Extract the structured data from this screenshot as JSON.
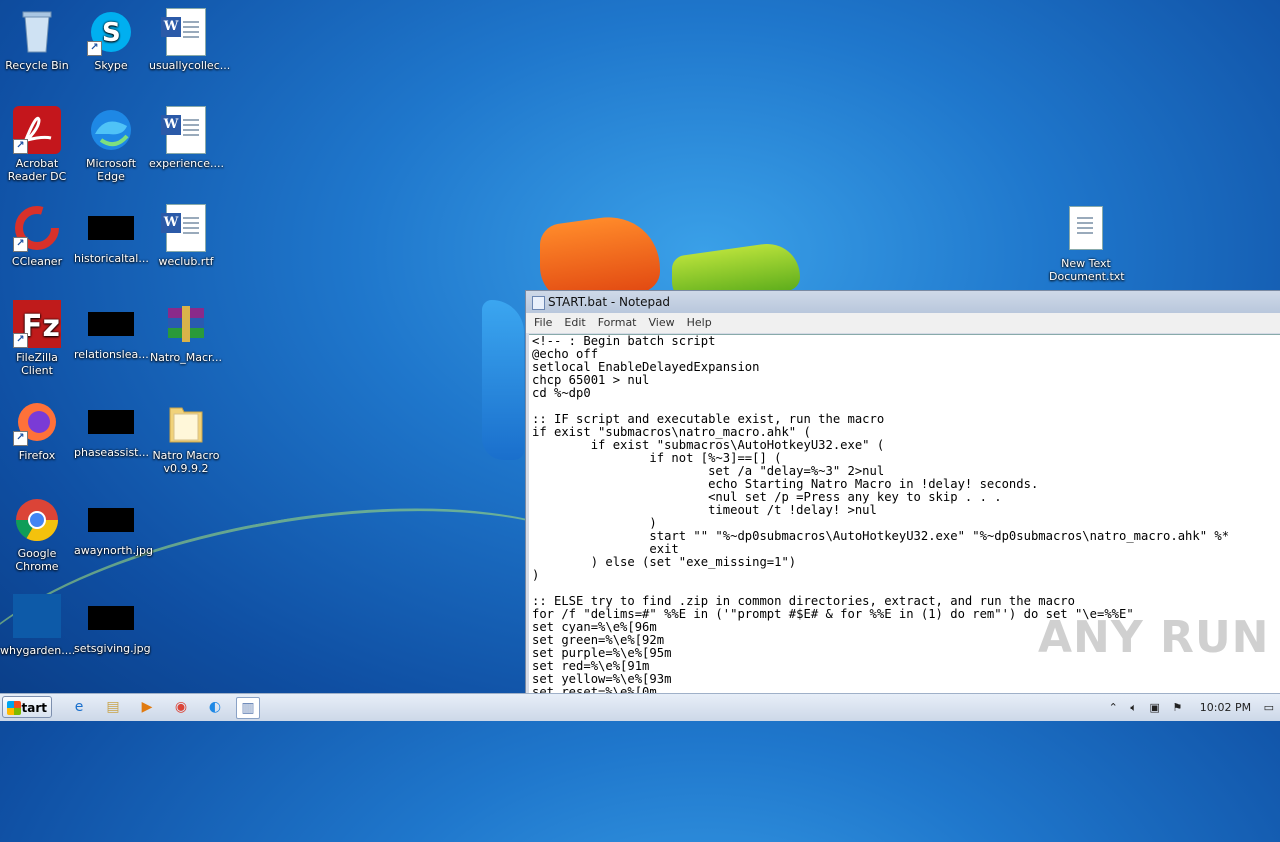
{
  "desktop": {
    "icons": [
      {
        "label": "Recycle Bin"
      },
      {
        "label": "Skype"
      },
      {
        "label": "usuallycollec..."
      },
      {
        "label": "Acrobat Reader DC"
      },
      {
        "label": "Microsoft Edge"
      },
      {
        "label": "experience...."
      },
      {
        "label": "CCleaner"
      },
      {
        "label": "historicaltal..."
      },
      {
        "label": "weclub.rtf"
      },
      {
        "label": "FileZilla Client"
      },
      {
        "label": "relationslea..."
      },
      {
        "label": "Natro_Macr..."
      },
      {
        "label": "Firefox"
      },
      {
        "label": "phaseassist..."
      },
      {
        "label": "Natro Macro v0.9.9.2"
      },
      {
        "label": "Google Chrome"
      },
      {
        "label": "awaynorth.jpg"
      },
      {
        "label": "whygarden...."
      },
      {
        "label": "setsgiving.jpg"
      },
      {
        "label": "New Text Document.txt"
      }
    ]
  },
  "notepad": {
    "title": "START.bat - Notepad",
    "menu": [
      "File",
      "Edit",
      "Format",
      "View",
      "Help"
    ],
    "content": "<!-- : Begin batch script\n@echo off\nsetlocal EnableDelayedExpansion\nchcp 65001 > nul\ncd %~dp0\n\n:: IF script and executable exist, run the macro\nif exist \"submacros\\natro_macro.ahk\" (\n        if exist \"submacros\\AutoHotkeyU32.exe\" (\n                if not [%~3]==[] (\n                        set /a \"delay=%~3\" 2>nul\n                        echo Starting Natro Macro in !delay! seconds.\n                        <nul set /p =Press any key to skip . . .\n                        timeout /t !delay! >nul\n                )\n                start \"\" \"%~dp0submacros\\AutoHotkeyU32.exe\" \"%~dp0submacros\\natro_macro.ahk\" %*\n                exit\n        ) else (set \"exe_missing=1\")\n)\n\n:: ELSE try to find .zip in common directories, extract, and run the macro\nfor /f \"delims=#\" %%E in ('\"prompt #$E# & for %%E in (1) do rem\"') do set \"\\e=%%E\"\nset cyan=%\\e%[96m\nset green=%\\e%[92m\nset purple=%\\e%[95m\nset red=%\\e%[91m\nset yellow=%\\e%[93m\nset reset=%\\e%[0m"
  },
  "watermark": "ANY RUN",
  "taskbar": {
    "start_label": "Start",
    "clock": "10:02 PM"
  }
}
